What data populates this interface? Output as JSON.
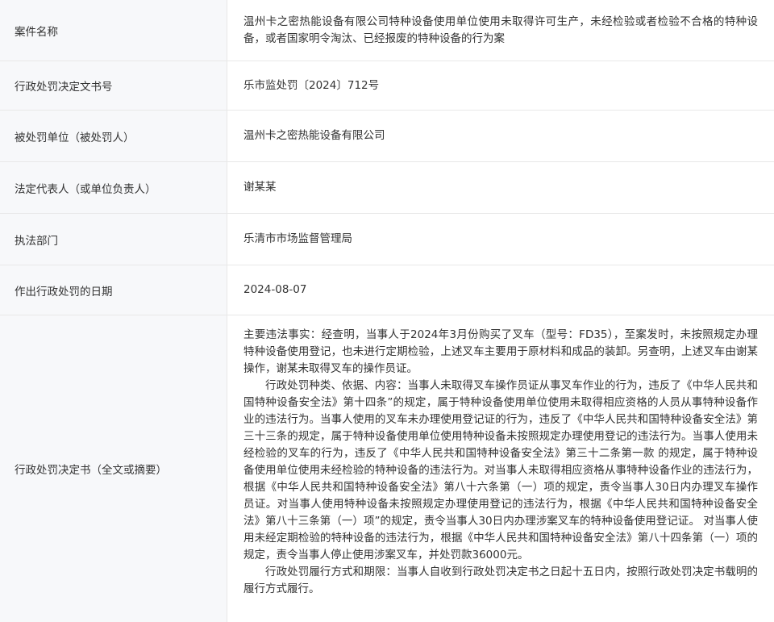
{
  "rows": [
    {
      "label": "案件名称",
      "value": "温州卡之密热能设备有限公司特种设备使用单位使用未取得许可生产，未经检验或者检验不合格的特种设备，或者国家明令淘汰、已经报废的特种设备的行为案"
    },
    {
      "label": "行政处罚决定文书号",
      "value": "乐市监处罚〔2024〕712号"
    },
    {
      "label": "被处罚单位（被处罚人）",
      "value": "温州卡之密热能设备有限公司"
    },
    {
      "label": "法定代表人（或单位负责人）",
      "value": "谢某某"
    },
    {
      "label": "执法部门",
      "value": "乐清市市场监督管理局"
    },
    {
      "label": "作出行政处罚的日期",
      "value": "2024-08-07"
    },
    {
      "label": "行政处罚决定书（全文或摘要）",
      "paragraphs": [
        "主要违法事实：经查明，当事人于2024年3月份购买了叉车（型号：FD35），至案发时，未按照规定办理特种设备使用登记，也未进行定期检验，上述叉车主要用于原材料和成品的装卸。另查明，上述叉车由谢某操作，谢某未取得叉车的操作员证。",
        "行政处罚种类、依据、内容：当事人未取得叉车操作员证从事叉车作业的行为，违反了《中华人民共和国特种设备安全法》第十四条”的规定，属于特种设备使用单位使用未取得相应资格的人员从事特种设备作业的违法行为。当事人使用的叉车未办理使用登记证的行为，违反了《中华人民共和国特种设备安全法》第三十三条的规定，属于特种设备使用单位使用特种设备未按照规定办理使用登记的违法行为。当事人使用未经检验的叉车的行为，违反了《中华人民共和国特种设备安全法》第三十二条第一款 的规定，属于特种设备使用单位使用未经检验的特种设备的违法行为。对当事人未取得相应资格从事特种设备作业的违法行为，根据《中华人民共和国特种设备安全法》第八十六条第（一）项的规定，责令当事人30日内办理叉车操作员证。对当事人使用特种设备未按照规定办理使用登记的违法行为，根据《中华人民共和国特种设备安全法》第八十三条第（一）项”的规定，责令当事人30日内办理涉案叉车的特种设备使用登记证。 对当事人使用未经定期检验的特种设备的违法行为，根据《中华人民共和国特种设备安全法》第八十四条第（一）项的规定，责令当事人停止使用涉案叉车，并处罚款36000元。",
        "行政处罚履行方式和期限：当事人自收到行政处罚决定书之日起十五日内，按照行政处罚决定书载明的履行方式履行。"
      ]
    }
  ]
}
